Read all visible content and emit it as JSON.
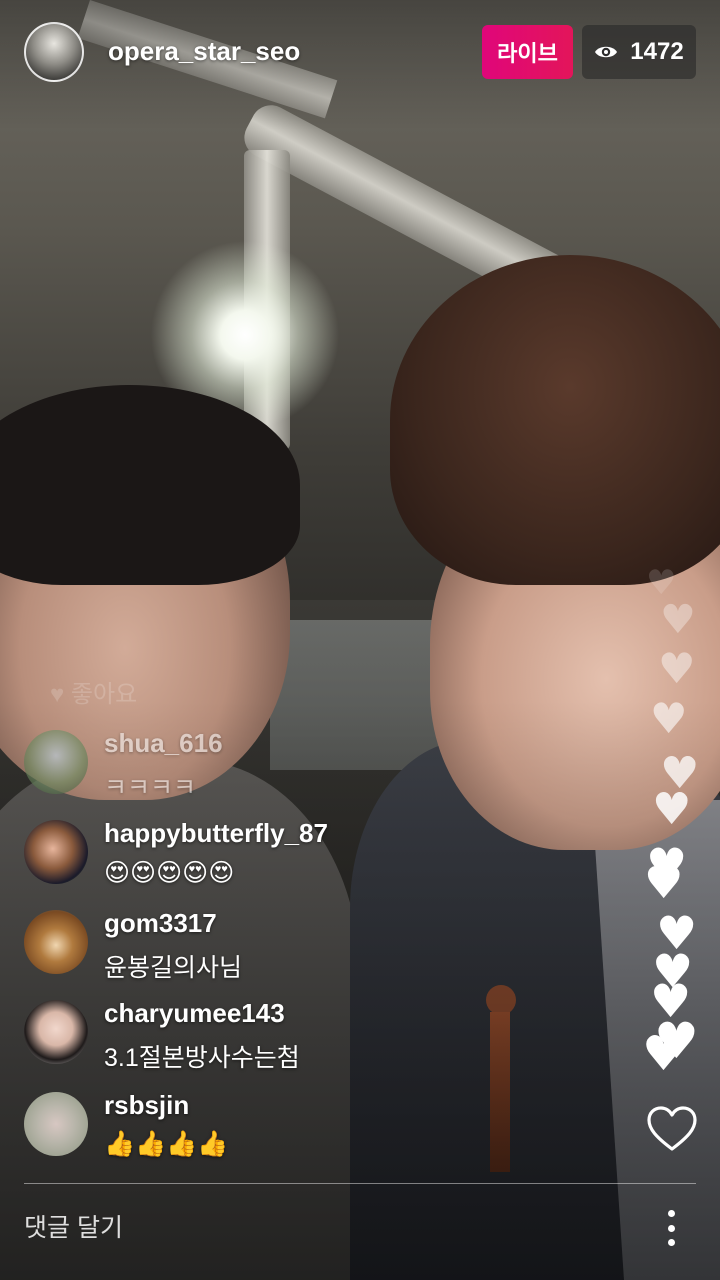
{
  "header": {
    "username": "opera_star_seo",
    "live_label": "라이브",
    "viewer_count": "1472",
    "viewer_icon": "eye-icon",
    "live_color": "#e0067a"
  },
  "ghost_comment": "♥ 좋아요",
  "comments": [
    {
      "user": "shua_616",
      "text": "ㅋㅋㅋㅋ"
    },
    {
      "user": "happybutterfly_87",
      "text": "😍😍😍😍😍"
    },
    {
      "user": "gom3317",
      "text": "윤봉길의사님"
    },
    {
      "user": "charyumee143",
      "text": "3.1절본방사수는첨"
    },
    {
      "user": "rsbsjin",
      "text": "👍👍👍👍"
    }
  ],
  "footer": {
    "comment_placeholder": "댓글 달기",
    "more_icon": "more-vertical-icon",
    "like_icon": "heart-outline-icon"
  }
}
